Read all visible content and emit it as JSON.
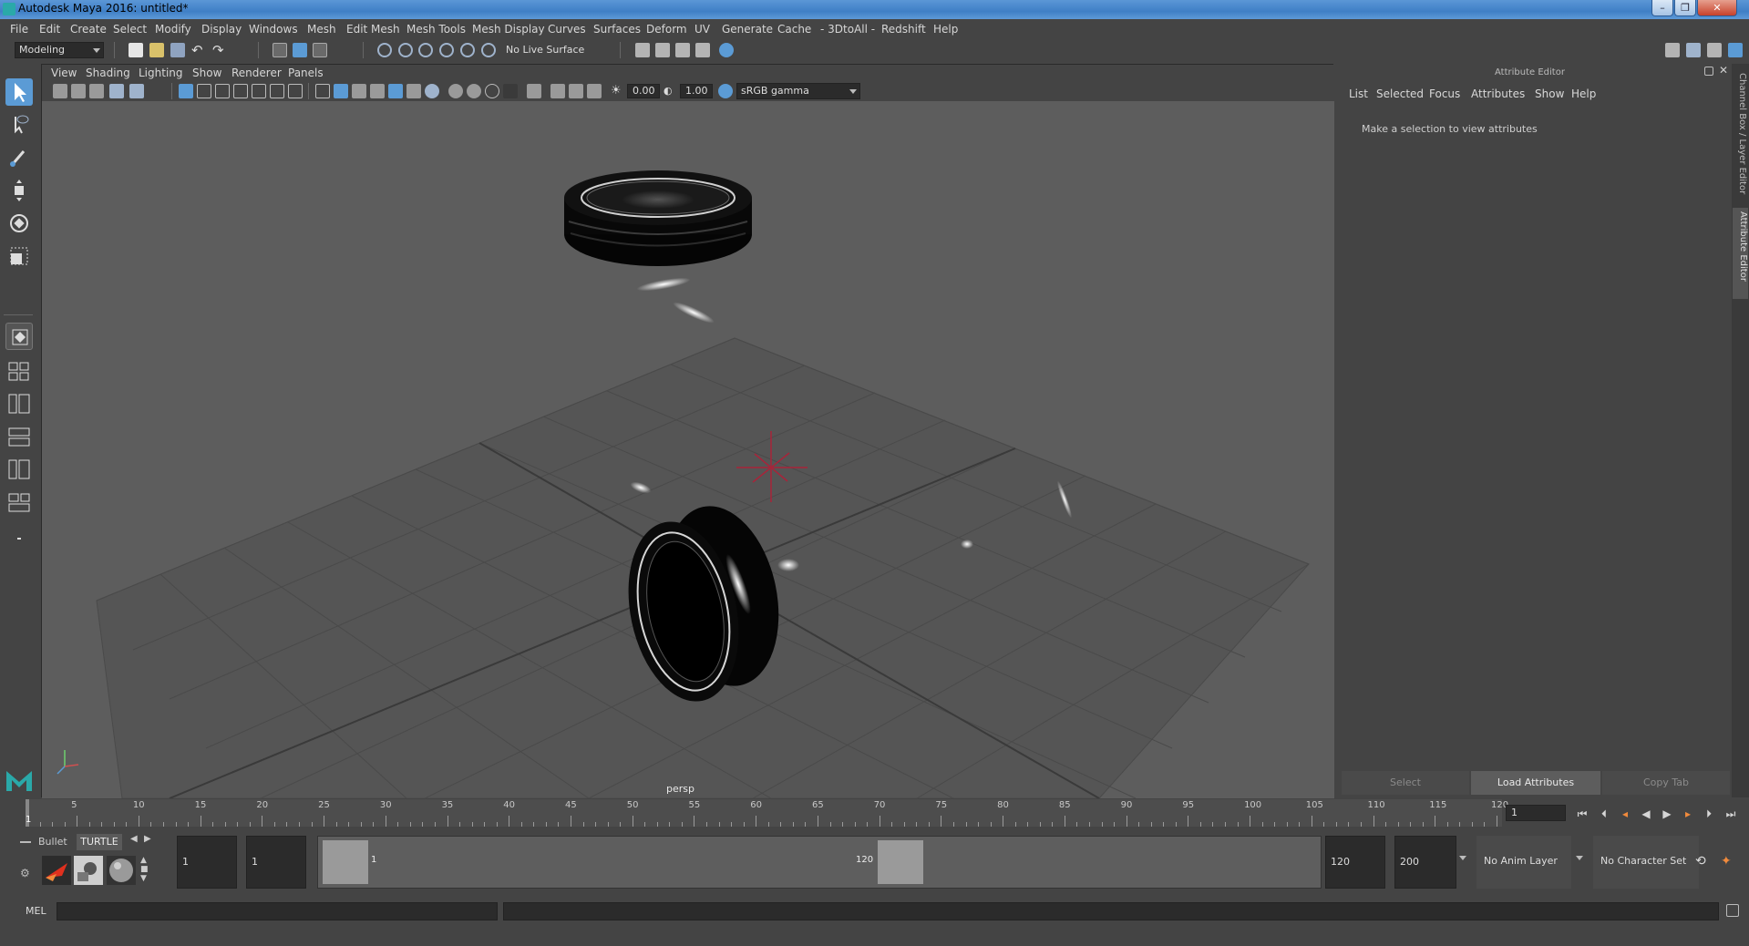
{
  "window": {
    "title": "Autodesk Maya 2016: untitled*",
    "controls": {
      "minimize": "–",
      "restore": "❐",
      "close": "✕"
    }
  },
  "menubar": [
    "File",
    "Edit",
    "Create",
    "Select",
    "Modify",
    "Display",
    "Windows",
    "Mesh",
    "Edit Mesh",
    "Mesh Tools",
    "Mesh Display",
    "Curves",
    "Surfaces",
    "Deform",
    "UV",
    "Generate",
    "Cache",
    "- 3DtoAll -",
    "Redshift",
    "Help"
  ],
  "toolbar": {
    "mode": "Modeling",
    "live_surface": "No Live Surface"
  },
  "viewport": {
    "menu": [
      "View",
      "Shading",
      "Lighting",
      "Show",
      "Renderer",
      "Panels"
    ],
    "exposure": "0.00",
    "gamma": "1.00",
    "color_space": "sRGB gamma",
    "camera_label": "persp"
  },
  "attribute_editor": {
    "title": "Attribute Editor",
    "menu": [
      "List",
      "Selected",
      "Focus",
      "Attributes",
      "Show",
      "Help"
    ],
    "message": "Make a selection to view attributes",
    "buttons": {
      "select": "Select",
      "load": "Load Attributes",
      "copy": "Copy Tab"
    }
  },
  "side_tabs": {
    "channel_box": "Channel Box / Layer Editor",
    "attribute_editor": "Attribute Editor"
  },
  "timeline": {
    "ticks": [
      5,
      10,
      15,
      20,
      25,
      30,
      35,
      40,
      45,
      50,
      55,
      60,
      65,
      70,
      75,
      80,
      85,
      90,
      95,
      100,
      105,
      110,
      115,
      120
    ],
    "current_marker": "1",
    "current_frame": "1"
  },
  "shelf": {
    "tabs": [
      "Bullet",
      "TURTLE"
    ]
  },
  "range": {
    "start": "1",
    "playback_start": "1",
    "slider_start": "1",
    "slider_end": "120",
    "playback_end": "120",
    "end": "200",
    "anim_layer": "No Anim Layer",
    "character_set": "No Character Set"
  },
  "cmdline": {
    "label": "MEL"
  },
  "colors": {
    "accent": "#5b9bd5",
    "viewport_bg": "#5d5d5d",
    "panel_bg": "#444444",
    "origin_marker": "#a8243a"
  }
}
